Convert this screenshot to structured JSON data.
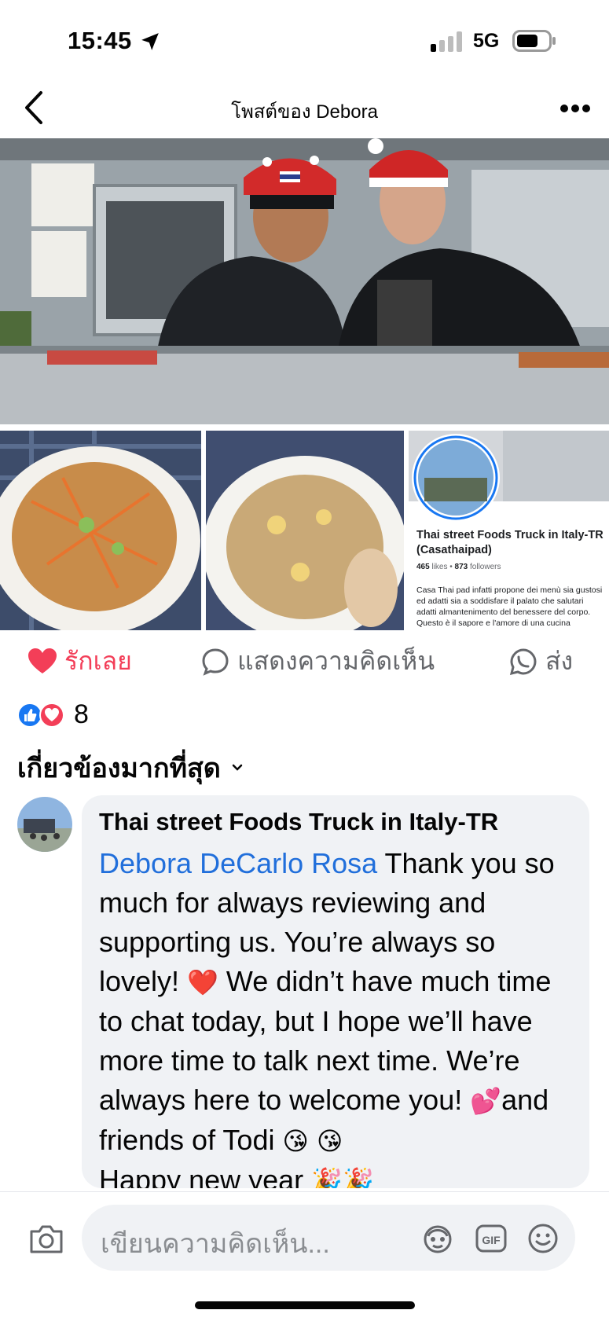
{
  "status_bar": {
    "time": "15:45",
    "network": "5G"
  },
  "header": {
    "title": "โพสต์ของ Debora"
  },
  "page_card": {
    "name": "Thai street Foods Truck in Italy-TR (Casathaipad)",
    "likes_count": "465",
    "likes_label": "likes",
    "followers_count": "873",
    "followers_label": "followers",
    "description": "Casa Thai pad infatti propone dei menù sia gustosi ed adatti sia a soddisfare il palato che salutari adatti almantenimento del benessere del corpo. Questo è il sapore e l'amore di una cucina"
  },
  "actions": {
    "love_label": "รักเลย",
    "comment_label": "แสดงความคิดเห็น",
    "share_label": "ส่ง"
  },
  "reactions": {
    "count": "8"
  },
  "sort": {
    "label": "เกี่ยวข้องมากที่สุด"
  },
  "comment": {
    "author": "Thai street Foods Truck in Italy-TR",
    "mention": "Debora DeCarlo Rosa",
    "text_part1": " Thank you so much for always reviewing and supporting us. You’re always so lovely! ",
    "heart_emoji": "❤️",
    "text_part2": " We didn’t have much time to chat today, but I hope we’ll have more time to talk next time. We’re always here to welcome you! ",
    "hearts_emoji": "💕",
    "text_part3": "and friends of Todi ",
    "kiss_emoji": "😘 😘",
    "text_part4": "Happy new year ",
    "party_emoji": "🎉🎉"
  },
  "composer": {
    "placeholder": "เขียนความคิดเห็น..."
  },
  "colors": {
    "accent_blue": "#216fdb",
    "love_red": "#f33e58",
    "bubble_bg": "#f0f2f5"
  }
}
